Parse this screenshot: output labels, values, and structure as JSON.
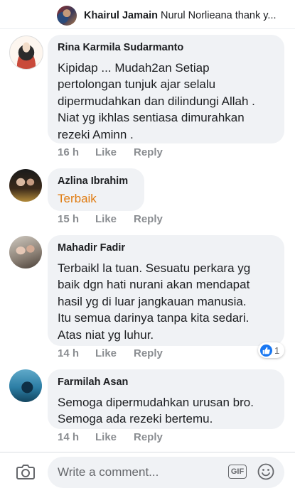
{
  "top_reply": {
    "author": "Khairul Jamain",
    "text": "Nurul Norlieana thank y..."
  },
  "comments": [
    {
      "author": "Rina Karmila Sudarmanto",
      "lines": [
        "Kipidap ... Mudah2an Setiap",
        "pertolongan tunjuk ajar selalu",
        "dipermudahkan dan dilindungi Allah .",
        "Niat yg ikhlas sentiasa dimurahkan",
        "rezeki Aminn ."
      ],
      "time": "16 h",
      "like": "Like",
      "reply": "Reply"
    },
    {
      "author": "Azlina Ibrahim",
      "lines": [
        "Terbaik"
      ],
      "time": "15 h",
      "like": "Like",
      "reply": "Reply"
    },
    {
      "author": "Mahadir Fadir",
      "lines": [
        "Terbaikl la tuan. Sesuatu perkara yg",
        "baik dgn hati nurani akan mendapat",
        "hasil yg di luar jangkauan manusia.",
        "Itu semua darinya tanpa kita sedari.",
        "Atas niat yg luhur."
      ],
      "time": "14 h",
      "like": "Like",
      "reply": "Reply",
      "reaction_count": "1"
    },
    {
      "author": "Farmilah Asan",
      "lines": [
        "Semoga dipermudahkan urusan bro.",
        "Semoga ada rezeki bertemu."
      ],
      "time": "14 h",
      "like": "Like",
      "reply": "Reply"
    }
  ],
  "composer": {
    "placeholder": "Write a comment...",
    "gif_label": "GIF"
  },
  "colors": {
    "bubble": "#f0f2f5",
    "meta": "#8a8d91",
    "highlight_text": "#e07b10",
    "like_blue": "#1877f2"
  },
  "icons": [
    "camera-icon",
    "gif-icon",
    "emoji-icon",
    "like-reaction-icon"
  ]
}
